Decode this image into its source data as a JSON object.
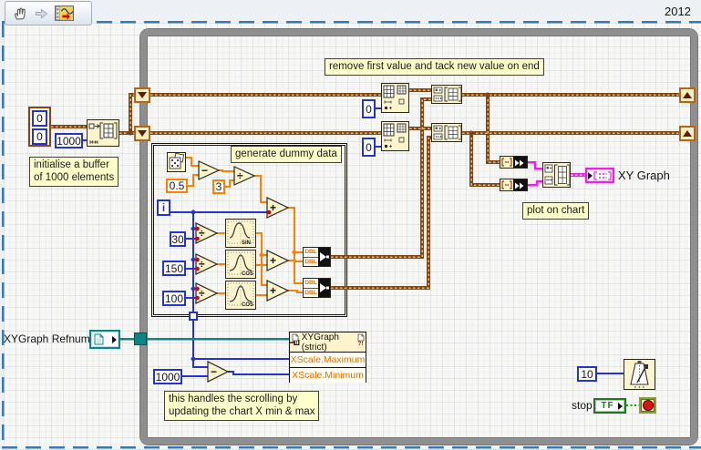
{
  "app": {
    "title_year": "2012"
  },
  "toolbar": {
    "icons": [
      "pan-hand",
      "forward-arrow",
      "vi-document"
    ]
  },
  "comments": {
    "remove_tack": "remove first value and tack new value on end",
    "generate_dummy": "generate dummy data",
    "init_buffer_1": "initialise a buffer",
    "init_buffer_2": "of 1000 elements",
    "plot_on_chart": "plot on chart",
    "scrolling_1": "this handles the scrolling by",
    "scrolling_2": "updating the chart X min & max"
  },
  "constants": {
    "cluster_x": "0",
    "cluster_y": "0",
    "buffer_size": "1000",
    "noise_offset": "0.5",
    "noise_scale": "3",
    "sin_period": "30",
    "cos1_period": "150",
    "cos2_period": "100",
    "delete_index_top": "0",
    "delete_index_bottom": "0",
    "window_width": "1000",
    "wait_ms": "10"
  },
  "terminals": {
    "iteration": "i",
    "xy_graph": "XY Graph",
    "refnum_label": "XYGraph Refnum",
    "stop_label": "stop",
    "stop_bool": "TF"
  },
  "property_node": {
    "header": "XYGraph (strict)",
    "rows": [
      "XScale.Maximum",
      "XScale.Minimum"
    ],
    "error_glyph": "?!"
  },
  "bundle": {
    "type_label": "DBL"
  },
  "operators": {
    "subtract": "−",
    "divide": "÷",
    "add": "+"
  },
  "waveform": {
    "sin": "SIN",
    "cos": "COS"
  },
  "icons": {
    "random": "dice",
    "sine": "sine-wave",
    "cosine": "bell-curve",
    "wait": "metronome",
    "loop_condition": "red-stop-circle",
    "refnum": "page"
  },
  "colors": {
    "wire_array_cluster": "#7e4612",
    "wire_scalar_dbl": "#ff8000",
    "wire_int": "#2434cc",
    "wire_refnum": "#0b8585",
    "wire_cluster_pink": "#e823e8",
    "wire_boolean": "#0fa00f",
    "node_fill": "#fbf4cd",
    "comment_fill": "#ffffcc",
    "loop_border": "#8f8f8f",
    "property_text": "#e87000",
    "boundary_dash": "#3a78b5"
  }
}
